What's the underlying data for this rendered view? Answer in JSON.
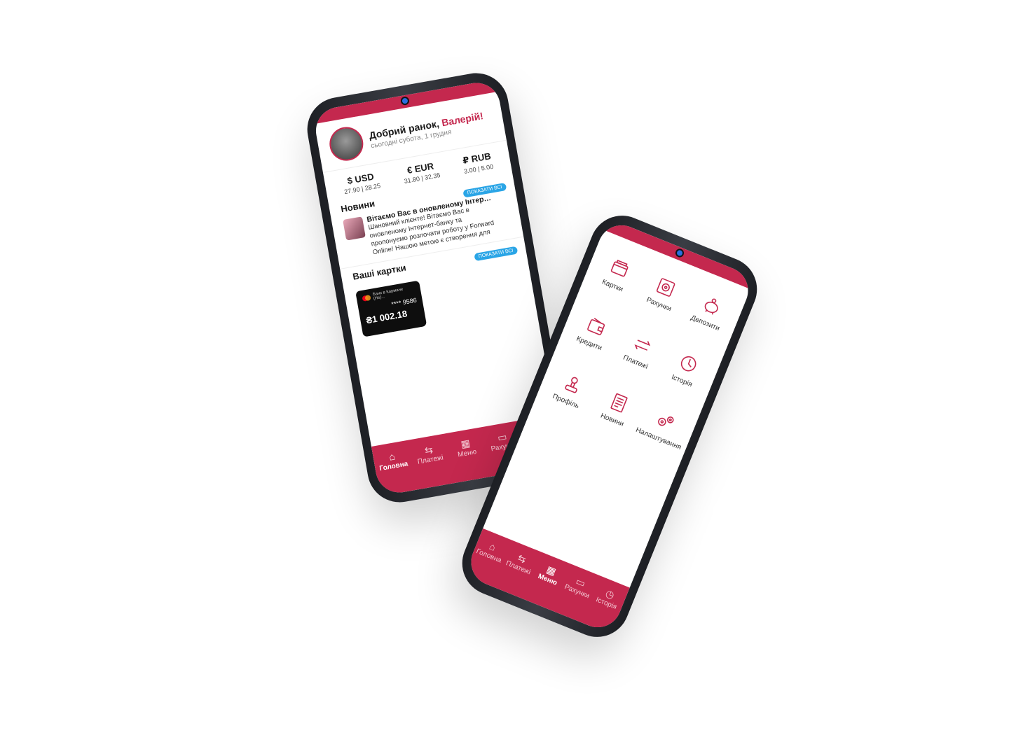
{
  "accent_color": "#c4284e",
  "home": {
    "greeting_prefix": "Добрий ранок, ",
    "greeting_name": "Валерій!",
    "date_line": "сьогодні субота, 1 грудня",
    "rates": [
      {
        "code": "$ USD",
        "value": "27.90 | 28.25"
      },
      {
        "code": "€ EUR",
        "value": "31.80 | 32.35"
      },
      {
        "code": "₽ RUB",
        "value": "3.00 | 5.00"
      }
    ],
    "news_title": "Новини",
    "show_all_news": "показати всі",
    "news_item": {
      "title": "Вітаємо Вас в оновленому Інтернет-ба...",
      "text": "Шановний клієнте! Вітаємо Вас в оновленому Інтернет-банку та пропонуємо розпочати роботу у Forward Online! Нашою метою є створення для"
    },
    "cards_title": "Ваші картки",
    "show_all_cards": "показати всі",
    "card": {
      "name": "Банк в Кармане (Не)...",
      "number": "**** 9586",
      "balance": "₴1 002.18"
    }
  },
  "nav": [
    {
      "label": "Головна",
      "icon": "home-icon"
    },
    {
      "label": "Платежі",
      "icon": "transfer-icon"
    },
    {
      "label": "Меню",
      "icon": "grid-icon"
    },
    {
      "label": "Рахунки",
      "icon": "card-icon"
    },
    {
      "label": "Історія",
      "icon": "clock-icon"
    }
  ],
  "menu": [
    {
      "label": "Картки",
      "icon": "cards-icon"
    },
    {
      "label": "Рахунки",
      "icon": "safe-icon"
    },
    {
      "label": "Депозити",
      "icon": "piggy-bank-icon"
    },
    {
      "label": "Кредити",
      "icon": "wallet-icon"
    },
    {
      "label": "Платежі",
      "icon": "transfer-icon"
    },
    {
      "label": "Історія",
      "icon": "clock-icon"
    },
    {
      "label": "Профіль",
      "icon": "profile-icon"
    },
    {
      "label": "Новини",
      "icon": "newspaper-icon"
    },
    {
      "label": "Налаштування",
      "icon": "gears-icon"
    }
  ]
}
